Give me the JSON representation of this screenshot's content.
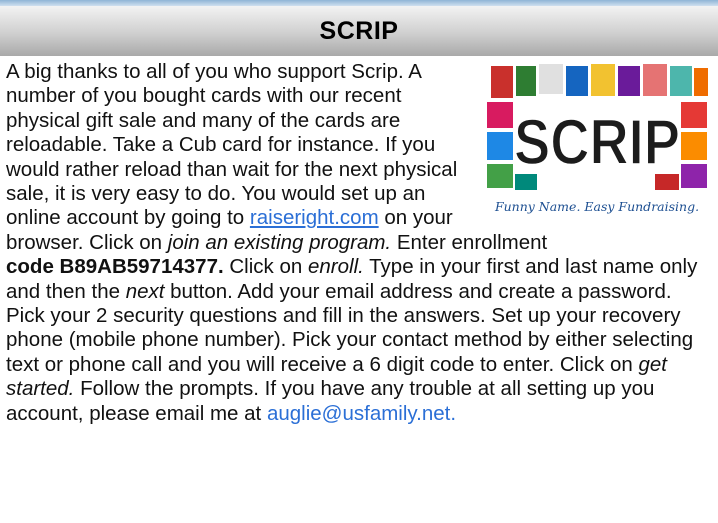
{
  "header": {
    "title": "SCRIP"
  },
  "image": {
    "wordmark": "SCRIP",
    "tagline": "Funny Name. Easy Fundraising."
  },
  "article": {
    "t1": "A big thanks to all of you who support Scrip.  A number of you bought cards with our recent physical gift sale and many of the cards are reloadable. Take a Cub card for instance.  If you would rather reload than wait for the next physical sale, it is very easy to do. You would set up an online account by going to ",
    "link_site": "raiseright.com",
    "t2": " on your browser. Click on ",
    "em_join": "join an existing program.",
    "t3": " Enter enrollment ",
    "strong_code": "code B89AB59714377.",
    "t4": " Click on ",
    "em_enroll": "enroll.",
    "t5": " Type in your first and last name only and then the ",
    "em_next": "next",
    "t6": " button. Add your email ad­dress and create a password. Pick your 2 security questions and fill in the answers. Set up your recovery phone (mobile phone number). Pick your contact method by either selecting text or phone call and you will receive a 6 digit code to enter. Click on ",
    "em_started": "get started.",
    "t7": " Follow the prompts.  If you have any trou­ble at all setting up you account, please email me at ",
    "link_email": "auglie@usfamily.net."
  }
}
